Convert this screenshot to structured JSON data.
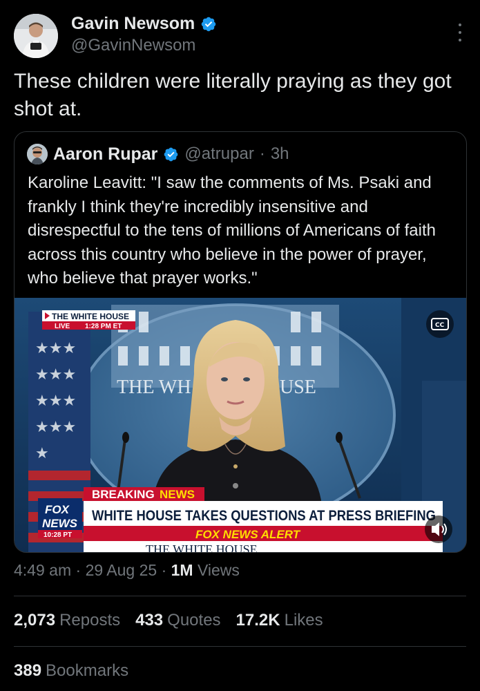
{
  "author": {
    "name": "Gavin Newsom",
    "handle": "@GavinNewsom",
    "verified_color": "#1d9bf0"
  },
  "tweet": {
    "text": "These children were literally praying as they got shot at."
  },
  "quoted_tweet": {
    "author_name": "Aaron Rupar",
    "author_handle": "@atrupar",
    "separator": "·",
    "time": "3h",
    "text": "Karoline Leavitt: \"I saw the comments of Ms. Psaki and frankly I think they're incredibly insensitive and disrespectful to the tens of millions of Americans of faith across this country who believe in the power of prayer, who believe that prayer works.\"",
    "video": {
      "channel_label": "THE WHITE HOUSE",
      "live_label": "LIVE",
      "live_time": "1:28 PM ET",
      "podium_text_left": "THE WH",
      "podium_text_right": "USE",
      "breaking_label": "BREAKING",
      "news_label": "NEWS",
      "headline": "WHITE HOUSE TAKES QUESTIONS AT PRESS BRIEFING",
      "alert": "FOX NEWS ALERT",
      "fox_logo_top": "FOX",
      "fox_logo_bottom": "NEWS",
      "fox_time": "10:28 PT",
      "bottom_text": "THE WHITE HOUSE",
      "cc_label": "CC"
    }
  },
  "meta": {
    "time": "4:49 am",
    "sep1": "·",
    "date": "29 Aug 25",
    "sep2": "·",
    "views_count": "1M",
    "views_label": "Views"
  },
  "stats": {
    "reposts_count": "2,073",
    "reposts_label": "Reposts",
    "quotes_count": "433",
    "quotes_label": "Quotes",
    "likes_count": "17.2K",
    "likes_label": "Likes",
    "bookmarks_count": "389",
    "bookmarks_label": "Bookmarks"
  },
  "colors": {
    "background": "#000000",
    "text_primary": "#e7e9ea",
    "text_secondary": "#71767b",
    "divider": "#2f3336",
    "verified": "#1d9bf0"
  }
}
